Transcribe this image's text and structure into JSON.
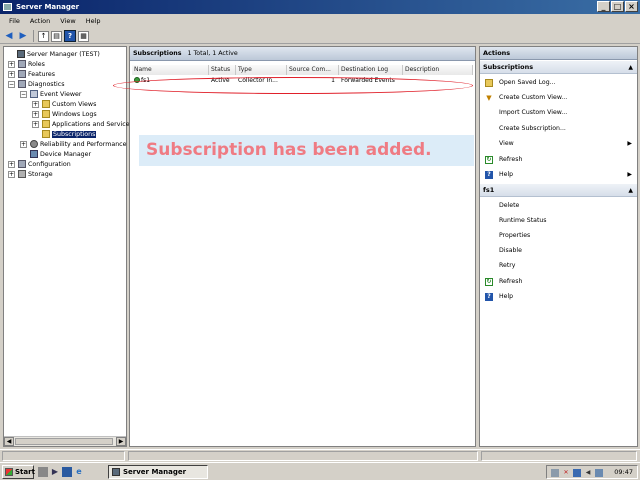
{
  "window": {
    "title": "Server Manager",
    "controls": [
      "_",
      "□",
      "×"
    ]
  },
  "menu": [
    "File",
    "Action",
    "View",
    "Help"
  ],
  "tree": {
    "items": [
      {
        "label": "Server Manager (TEST)",
        "icon": "server-icon"
      },
      {
        "label": "Roles",
        "icon": "roles-icon"
      },
      {
        "label": "Features",
        "icon": "features-icon"
      },
      {
        "label": "Diagnostics",
        "icon": "diagnostics-icon"
      },
      {
        "label": "Event Viewer",
        "icon": "event-viewer-icon"
      },
      {
        "label": "Custom Views",
        "icon": "folder-icon"
      },
      {
        "label": "Windows Logs",
        "icon": "folder-icon"
      },
      {
        "label": "Applications and Service",
        "icon": "folder-icon"
      },
      {
        "label": "Subscriptions",
        "icon": "subscriptions-icon"
      },
      {
        "label": "Reliability and Performance",
        "icon": "gauge-icon"
      },
      {
        "label": "Device Manager",
        "icon": "device-icon"
      },
      {
        "label": "Configuration",
        "icon": "configuration-icon"
      },
      {
        "label": "Storage",
        "icon": "storage-icon"
      }
    ]
  },
  "main": {
    "title": "Subscriptions",
    "summary": "1 Total, 1 Active",
    "columns": [
      "Name",
      "Status",
      "Type",
      "Source Com...",
      "Destination Log",
      "Description"
    ],
    "rows": [
      {
        "name": "fs1",
        "status": "Active",
        "type": "Collector In...",
        "source": "1",
        "destination": "Forwarded Events",
        "description": ""
      }
    ],
    "banner": "Subscription has been added."
  },
  "actions": {
    "title": "Actions",
    "sections": [
      {
        "title": "Subscriptions",
        "items": [
          "Open Saved Log...",
          "Create Custom View...",
          "Import Custom View...",
          "Create Subscription...",
          "View",
          "Refresh",
          "Help"
        ]
      },
      {
        "title": "fs1",
        "items": [
          "Delete",
          "Runtime Status",
          "Properties",
          "Disable",
          "Retry",
          "Refresh",
          "Help"
        ]
      }
    ]
  },
  "taskbar": {
    "start": "Start",
    "active_task": "Server Manager",
    "clock": "09:47"
  },
  "colors": {
    "banner_text": "#ef7b83",
    "banner_bg": "#dcecf8",
    "highlight_ellipse": "#e0202a",
    "titlebar": "#0a246a"
  }
}
